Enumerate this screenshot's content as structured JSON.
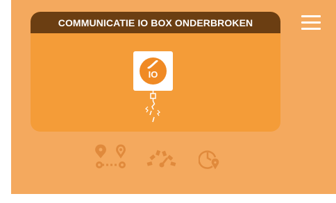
{
  "card": {
    "title": "COMMUNICATIE IO BOX ONDERBROKEN",
    "device_label": "IO"
  },
  "nav": {
    "icons": [
      "route-icon",
      "gauge-icon",
      "clock-location-icon"
    ]
  },
  "colors": {
    "background": "#f4a95e",
    "card": "#f49c38",
    "header": "#6b3e12",
    "accent": "#f08a24",
    "inactive_icon": "#e08a3c"
  }
}
